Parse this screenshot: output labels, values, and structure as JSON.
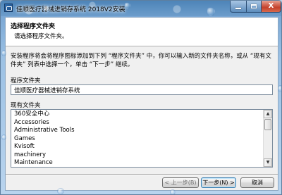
{
  "window": {
    "title": "佳顺医疗器械进销存系统 2018V2安装",
    "close_glyph": "X"
  },
  "header": {
    "title": "选择程序文件夹",
    "subtitle": "请选择程序文件夹。"
  },
  "description": "安装程序将会将程序图标添加到下列 “程序文件夹” 中，你可以输入新的文件夹名称，或从 “现有文件夹” 列表中选择一个，单击 “下一步” 继续。",
  "program_folder": {
    "label": "程序文件夹",
    "value": "佳顺医疗器械进销存系统"
  },
  "existing_folders": {
    "label": "现有文件夹",
    "items": [
      "360安全中心",
      "Accessories",
      "Administrative Tools",
      "Games",
      "Kvisoft",
      "machinery",
      "Maintenance"
    ]
  },
  "buttons": {
    "back": "< 上一步(B)",
    "next": "下一步(N) >",
    "cancel": "取消"
  },
  "icons": {
    "app": "installer-icon",
    "minimize": "minimize-icon",
    "maximize": "maximize-icon",
    "close": "close-icon",
    "scroll_up": "scroll-up-arrow-icon",
    "scroll_down": "scroll-down-arrow-icon"
  },
  "colors": {
    "frame": "#9cc1e4",
    "close_button": "#c4412b",
    "default_button_border": "#3c7fb1"
  }
}
